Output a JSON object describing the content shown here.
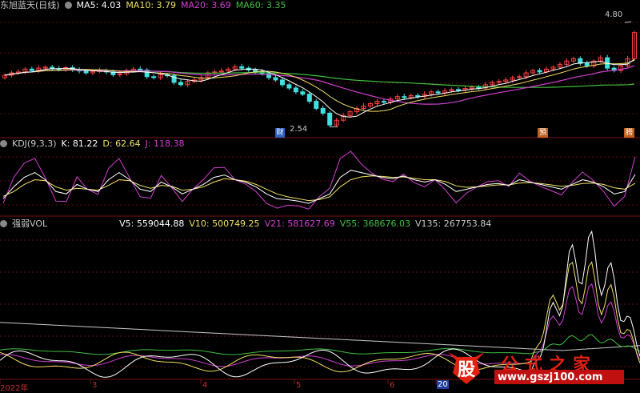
{
  "panels": {
    "price": {
      "title": "东旭蓝天(日线)",
      "ma": [
        {
          "label": "MA5: 4.03",
          "color": "#ffffff"
        },
        {
          "label": "MA10: 3.79",
          "color": "#f0e060"
        },
        {
          "label": "MA20: 3.69",
          "color": "#d040d0"
        },
        {
          "label": "MA60: 3.35",
          "color": "#40c040"
        }
      ],
      "max_label": "4.80",
      "min_label": "2.54",
      "badge_low": "财",
      "badge_a": "預",
      "badge_b": "腾"
    },
    "kdj": {
      "title": "KDJ(9,3,3)",
      "values": [
        {
          "label": "K: 81.22",
          "color": "#ffffff"
        },
        {
          "label": "D: 62.64",
          "color": "#f0e060"
        },
        {
          "label": "J: 118.38",
          "color": "#d040d0"
        }
      ]
    },
    "vol": {
      "title": "强弱VOL",
      "values": [
        {
          "label": "V5: 559044.88",
          "color": "#ffffff"
        },
        {
          "label": "V10: 500749.25",
          "color": "#f0e060"
        },
        {
          "label": "V21: 581627.69",
          "color": "#d040d0"
        },
        {
          "label": "V55: 368676.03",
          "color": "#40c040"
        },
        {
          "label": "V135: 267753.84",
          "color": "#c8c8c8"
        }
      ]
    }
  },
  "x_axis": {
    "labels": [
      "2022年",
      "3",
      "4",
      "5",
      "6",
      "20"
    ]
  },
  "watermark": {
    "logo_char": "股",
    "title": "公式之家",
    "url": "www.gszj100.com"
  },
  "chart_data": [
    {
      "type": "candlestick",
      "title": "东旭蓝天(日线)",
      "close": [
        3.65,
        3.7,
        3.72,
        3.78,
        3.75,
        3.8,
        3.82,
        3.79,
        3.77,
        3.81,
        3.76,
        3.74,
        3.7,
        3.73,
        3.75,
        3.72,
        3.66,
        3.68,
        3.75,
        3.78,
        3.76,
        3.62,
        3.6,
        3.66,
        3.64,
        3.5,
        3.45,
        3.52,
        3.55,
        3.6,
        3.7,
        3.72,
        3.74,
        3.78,
        3.83,
        3.8,
        3.76,
        3.72,
        3.68,
        3.6,
        3.55,
        3.45,
        3.38,
        3.3,
        3.25,
        3.1,
        2.95,
        2.85,
        2.6,
        2.7,
        2.8,
        2.88,
        2.95,
        3.0,
        3.05,
        3.1,
        3.08,
        3.15,
        3.2,
        3.18,
        3.22,
        3.2,
        3.25,
        3.3,
        3.28,
        3.32,
        3.35,
        3.34,
        3.37,
        3.4,
        3.38,
        3.45,
        3.5,
        3.52,
        3.55,
        3.6,
        3.62,
        3.7,
        3.75,
        3.72,
        3.78,
        3.82,
        3.88,
        3.95,
        4.0,
        3.9,
        3.85,
        3.95,
        4.02,
        3.8,
        3.75,
        3.85,
        4.0,
        4.55
      ],
      "max_label": 4.8,
      "min_label": 2.54,
      "ma": {
        "MA5": 4.03,
        "MA10": 3.79,
        "MA20": 3.69,
        "MA60": 3.35
      }
    },
    {
      "type": "line",
      "title": "KDJ(9,3,3)",
      "series": [
        {
          "name": "K",
          "last": 81.22,
          "values": [
            30,
            55,
            75,
            85,
            70,
            45,
            40,
            60,
            50,
            45,
            70,
            85,
            70,
            50,
            45,
            65,
            55,
            40,
            50,
            60,
            75,
            80,
            70,
            65,
            55,
            40,
            30,
            28,
            25,
            20,
            30,
            40,
            75,
            90,
            85,
            80,
            75,
            72,
            78,
            70,
            65,
            70,
            60,
            45,
            50,
            55,
            60,
            62,
            58,
            70,
            65,
            60,
            55,
            50,
            60,
            70,
            65,
            55,
            40,
            45,
            81.22
          ]
        },
        {
          "name": "D",
          "last": 62.64,
          "values": [
            35,
            45,
            60,
            70,
            68,
            55,
            48,
            52,
            50,
            48,
            58,
            70,
            68,
            58,
            52,
            58,
            56,
            48,
            50,
            55,
            65,
            72,
            70,
            67,
            60,
            50,
            40,
            34,
            30,
            26,
            28,
            34,
            55,
            70,
            76,
            78,
            77,
            75,
            76,
            73,
            70,
            70,
            66,
            57,
            54,
            55,
            57,
            59,
            59,
            63,
            64,
            62,
            59,
            56,
            58,
            62,
            63,
            60,
            53,
            50,
            62.64
          ]
        },
        {
          "name": "J",
          "last": 118.38,
          "values": [
            20,
            75,
            105,
            115,
            74,
            25,
            24,
            76,
            50,
            39,
            94,
            115,
            74,
            34,
            31,
            79,
            53,
            24,
            50,
            70,
            95,
            96,
            70,
            61,
            45,
            20,
            10,
            16,
            15,
            8,
            34,
            52,
            115,
            130,
            103,
            84,
            71,
            66,
            82,
            64,
            55,
            70,
            48,
            21,
            42,
            55,
            66,
            68,
            56,
            84,
            67,
            56,
            47,
            38,
            64,
            86,
            69,
            45,
            14,
            35,
            118.38
          ]
        }
      ]
    },
    {
      "type": "line",
      "title": "强弱VOL",
      "series": [
        {
          "name": "V5",
          "last": 559044.88
        },
        {
          "name": "V10",
          "last": 500749.25
        },
        {
          "name": "V21",
          "last": 581627.69
        },
        {
          "name": "V55",
          "last": 368676.03
        },
        {
          "name": "V135",
          "last": 267753.84
        }
      ]
    }
  ]
}
